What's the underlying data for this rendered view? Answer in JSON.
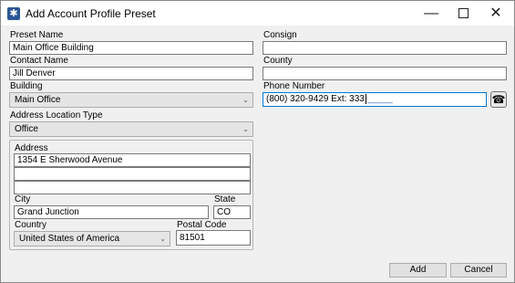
{
  "window": {
    "title": "Add Account Profile Preset",
    "min_symbol": "—",
    "close_symbol": "✕"
  },
  "form": {
    "preset_name": {
      "label": "Preset Name",
      "value": "Main Office Building"
    },
    "contact_name": {
      "label": "Contact Name",
      "value": "Jill Denver"
    },
    "building": {
      "label": "Building",
      "value": "Main Office"
    },
    "address_location_type": {
      "label": "Address Location Type",
      "value": "Office"
    },
    "consign": {
      "label": "Consign",
      "value": ""
    },
    "county": {
      "label": "County",
      "value": ""
    },
    "phone_number": {
      "label": "Phone Number",
      "value": "(800) 320-9429 Ext: 333",
      "mask": "_____"
    }
  },
  "address_group": {
    "address": {
      "label": "Address",
      "line1": "1354 E Sherwood Avenue",
      "line2": "",
      "line3": ""
    },
    "city": {
      "label": "City",
      "value": "Grand Junction"
    },
    "state": {
      "label": "State",
      "value": "CO"
    },
    "country": {
      "label": "Country",
      "value": "United States of America"
    },
    "postal_code": {
      "label": "Postal Code",
      "value": "81501"
    }
  },
  "buttons": {
    "add": "Add",
    "cancel": "Cancel"
  },
  "icons": {
    "app": "gear-icon",
    "phone": "telephone-icon",
    "dropdown": "chevron-down-icon"
  }
}
